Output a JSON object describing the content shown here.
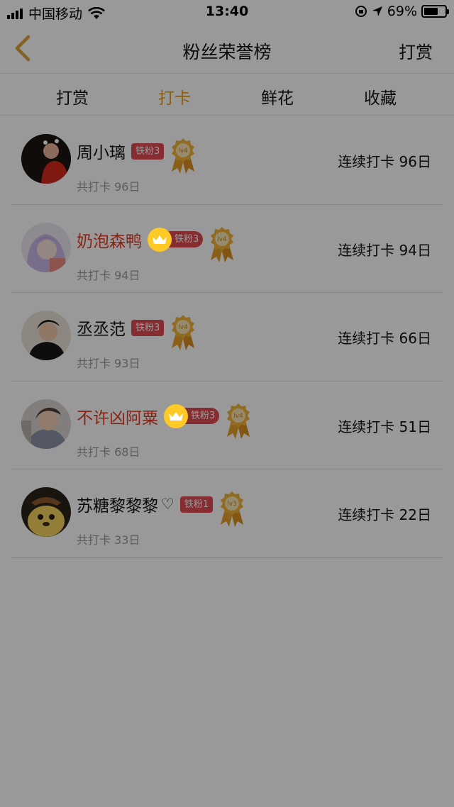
{
  "status_bar": {
    "carrier": "中国移动",
    "time": "13:40",
    "battery": "69%",
    "battery_level": 0.69
  },
  "nav": {
    "title": "粉丝荣誉榜",
    "right_label": "打赏"
  },
  "tabs": [
    {
      "label": "打赏",
      "active": false
    },
    {
      "label": "打卡",
      "active": true
    },
    {
      "label": "鲜花",
      "active": false
    },
    {
      "label": "收藏",
      "active": false
    }
  ],
  "rows": [
    {
      "name": "周小璃",
      "fan": "铁粉3",
      "level": "lv4",
      "total": "共打卡 96日",
      "streak": "连续打卡 96日"
    },
    {
      "name": "奶泡森鸭",
      "fan": "铁粉3",
      "level": "lv4",
      "total": "共打卡 94日",
      "streak": "连续打卡 94日"
    },
    {
      "name": "丞丞范",
      "fan": "铁粉3",
      "level": "lv4",
      "total": "共打卡 93日",
      "streak": "连续打卡 66日"
    },
    {
      "name": "不许凶阿粟",
      "fan": "铁粉3",
      "level": "lv4",
      "total": "共打卡 68日",
      "streak": "连续打卡 51日"
    },
    {
      "name": "苏糖黎黎黎",
      "heart": "♡",
      "fan": "铁粉1",
      "level": "lv3",
      "total": "共打卡 33日",
      "streak": "连续打卡 22日"
    }
  ],
  "colors": {
    "accent": "#e8a020",
    "fan_pill": "#e24a50",
    "crown_gold": "#ffc926",
    "name_red": "#e43a25",
    "overlay": "rgba(0,0,0,0.40)"
  }
}
